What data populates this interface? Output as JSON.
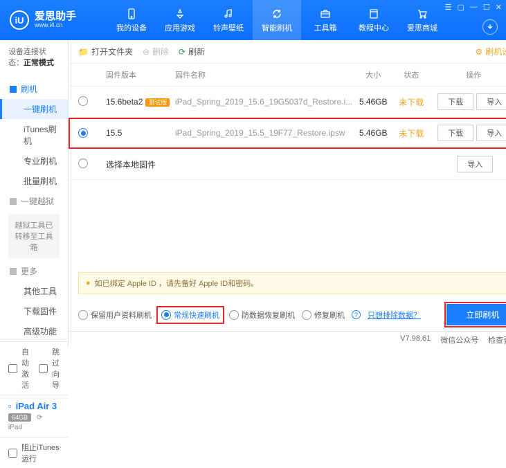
{
  "app": {
    "name": "爱思助手",
    "url": "www.i4.cn",
    "logo_letter": "iU"
  },
  "nav": {
    "tabs": [
      {
        "label": "我的设备",
        "icon": "phone"
      },
      {
        "label": "应用游戏",
        "icon": "apps"
      },
      {
        "label": "铃声壁纸",
        "icon": "music"
      },
      {
        "label": "智能刷机",
        "icon": "refresh",
        "active": true
      },
      {
        "label": "工具箱",
        "icon": "toolbox"
      },
      {
        "label": "教程中心",
        "icon": "book"
      },
      {
        "label": "爱思商城",
        "icon": "cart"
      }
    ]
  },
  "sidebar": {
    "conn_label": "设备连接状态：",
    "conn_value": "正常模式",
    "groups": [
      {
        "header": "刷机",
        "items": [
          {
            "label": "一键刷机",
            "active": true
          },
          {
            "label": "iTunes刷机"
          },
          {
            "label": "专业刷机"
          },
          {
            "label": "批量刷机"
          }
        ]
      },
      {
        "header": "一键越狱",
        "gray": true,
        "note": "越狱工具已转移至工具箱"
      },
      {
        "header": "更多",
        "gray": true,
        "items": [
          {
            "label": "其他工具"
          },
          {
            "label": "下载固件"
          },
          {
            "label": "高级功能"
          }
        ]
      }
    ],
    "auto_activate": "自动激活",
    "skip_guide": "跳过向导",
    "device": {
      "name": "iPad Air 3",
      "storage": "64GB",
      "type": "iPad"
    },
    "block_itunes": "阻止iTunes运行"
  },
  "toolbar": {
    "open_folder": "打开文件夹",
    "delete": "删除",
    "refresh": "刷新",
    "settings": "刷机设置"
  },
  "columns": {
    "version": "固件版本",
    "name": "固件名称",
    "size": "大小",
    "status": "状态",
    "ops": "操作"
  },
  "firmware": [
    {
      "version": "15.6beta2",
      "beta": "测试版",
      "name": "iPad_Spring_2019_15.6_19G5037d_Restore.i...",
      "size": "5.46GB",
      "status": "未下载",
      "download": "下载",
      "import": "导入"
    },
    {
      "version": "15.5",
      "name": "iPad_Spring_2019_15.5_19F77_Restore.ipsw",
      "size": "5.46GB",
      "status": "未下载",
      "download": "下载",
      "import": "导入",
      "selected": true
    },
    {
      "local": true,
      "label": "选择本地固件",
      "import": "导入"
    }
  ],
  "warning": {
    "text": "如已绑定 Apple ID ，请先备好 Apple ID和密码。"
  },
  "flash": {
    "opts": [
      {
        "label": "保留用户资料刷机"
      },
      {
        "label": "常规快速刷机",
        "checked": true,
        "hl": true
      },
      {
        "label": "防数据恢复刷机"
      },
      {
        "label": "修复刷机"
      }
    ],
    "exclude": "只想排除数据？",
    "button": "立即刷机"
  },
  "status": {
    "version": "V7.98.61",
    "wechat": "微信公众号",
    "check_update": "检查更新"
  }
}
